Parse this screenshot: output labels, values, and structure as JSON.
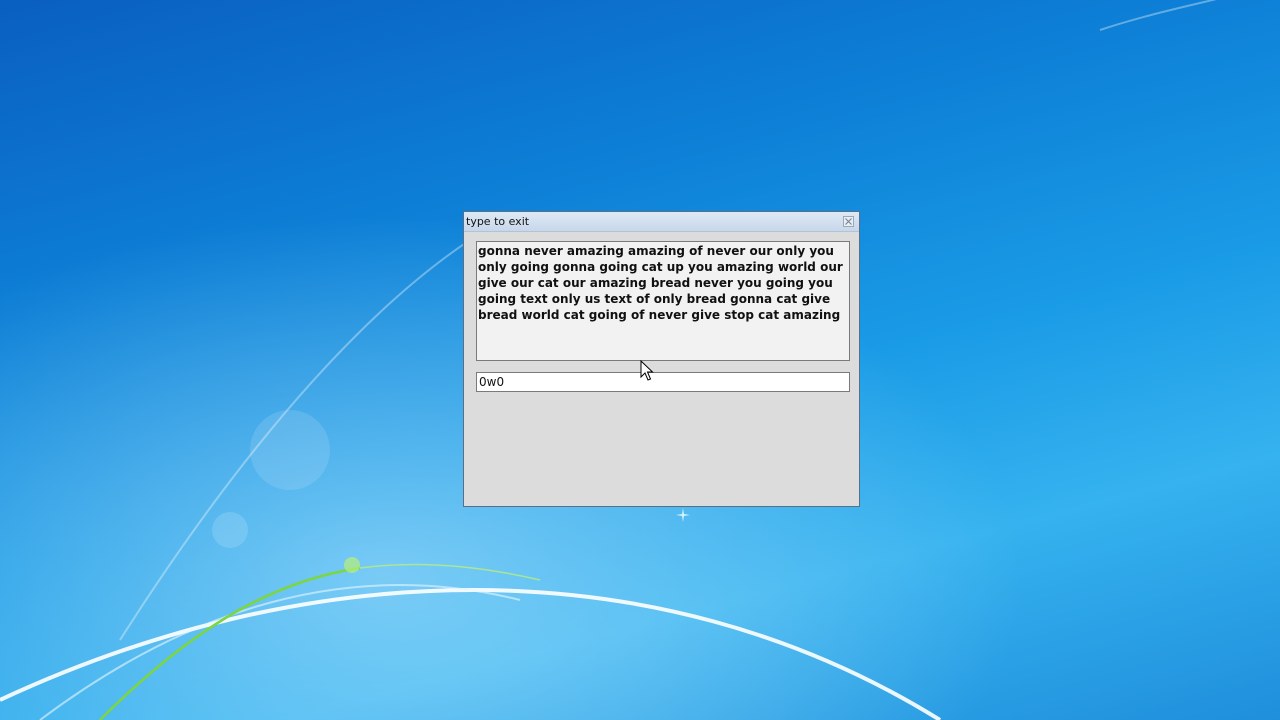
{
  "window": {
    "title": "type to exit",
    "close_icon": "close-icon"
  },
  "prompt_text": "gonna never amazing amazing of never our only you only going gonna going cat up you amazing world our give our cat our amazing bread never you going you going text only us text of only bread gonna cat give bread world cat going of never give stop cat amazing",
  "input": {
    "value": "0w0"
  },
  "colors": {
    "desktop_dark": "#0a5fc0",
    "desktop_light": "#35b2ef",
    "window_bg": "#dcdcdc",
    "titlebar": "#c7d7ea"
  }
}
